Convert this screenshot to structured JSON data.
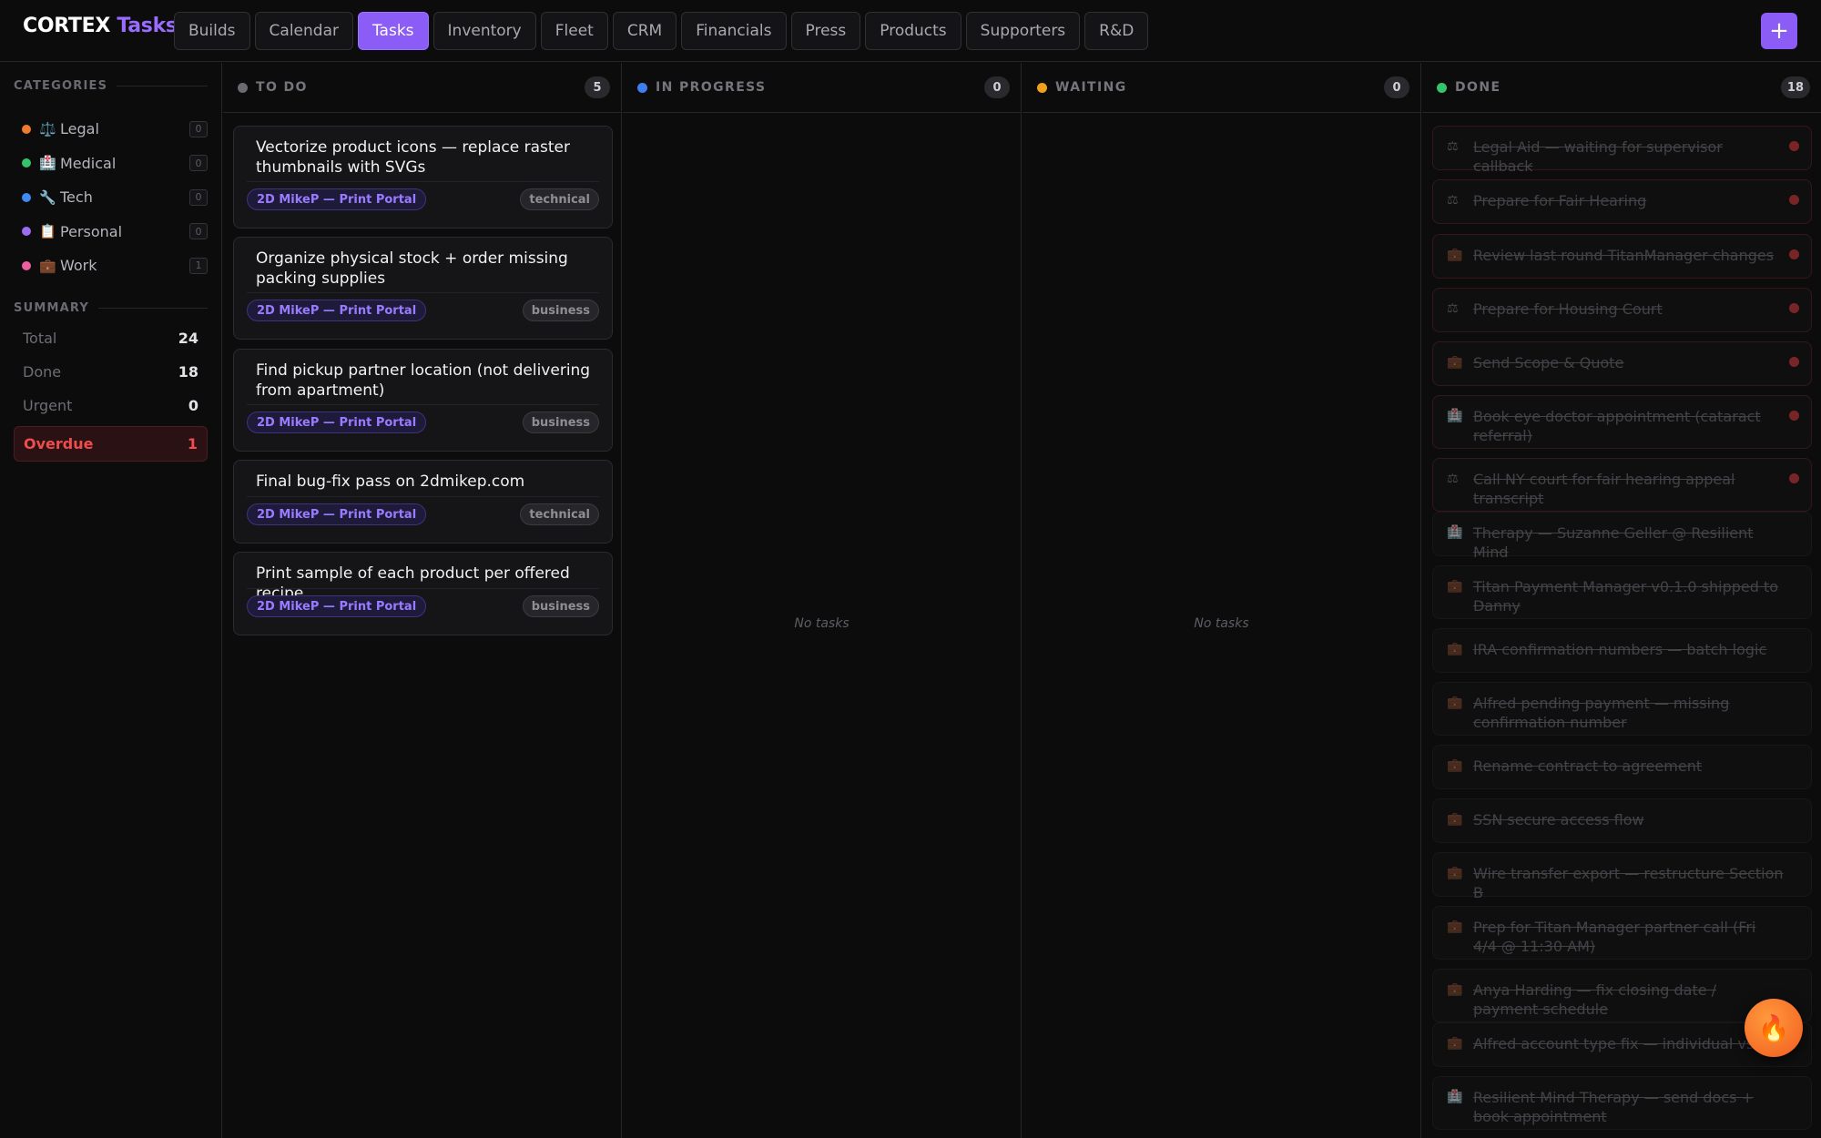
{
  "brand": {
    "name": "CORTEX",
    "accent": "Tasks"
  },
  "nav": {
    "tabs": [
      "Builds",
      "Calendar",
      "Tasks",
      "Inventory",
      "Fleet",
      "CRM",
      "Financials",
      "Press",
      "Products",
      "Supporters",
      "R&D"
    ],
    "active": "Tasks",
    "add_label": "+"
  },
  "sidebar": {
    "categories_heading": "CATEGORIES",
    "categories": [
      {
        "label": "Legal",
        "emoji": "⚖️",
        "color": "#f07b2c",
        "count": "0"
      },
      {
        "label": "Medical",
        "emoji": "🏥",
        "color": "#36c46b",
        "count": "0"
      },
      {
        "label": "Tech",
        "emoji": "🔧",
        "color": "#3f8bf0",
        "count": "0"
      },
      {
        "label": "Personal",
        "emoji": "📋",
        "color": "#9b6cf2",
        "count": "0"
      },
      {
        "label": "Work",
        "emoji": "💼",
        "color": "#ee5fa0",
        "count": "1"
      }
    ],
    "summary_heading": "SUMMARY",
    "summary": [
      {
        "label": "Total",
        "value": "24"
      },
      {
        "label": "Done",
        "value": "18"
      },
      {
        "label": "Urgent",
        "value": "0"
      }
    ],
    "overdue": {
      "label": "Overdue",
      "value": "1"
    }
  },
  "columns": {
    "todo": {
      "title": "TO DO",
      "count": "5",
      "color": "#6b6b72"
    },
    "in_progress": {
      "title": "IN PROGRESS",
      "count": "0",
      "color": "#3f7ef0",
      "empty": "No tasks"
    },
    "waiting": {
      "title": "WAITING",
      "count": "0",
      "color": "#f0a11c",
      "empty": "No tasks"
    },
    "done": {
      "title": "DONE",
      "count": "18",
      "color": "#36c46b"
    }
  },
  "todo_cards": [
    {
      "text": "Vectorize product icons — replace raster thumbnails with SVGs",
      "project": "2D MikeP — Print Portal",
      "tag": "technical"
    },
    {
      "text": "Organize physical stock + order missing packing supplies",
      "project": "2D MikeP — Print Portal",
      "tag": "business"
    },
    {
      "text": "Find pickup partner location (not delivering from apartment)",
      "project": "2D MikeP — Print Portal",
      "tag": "business"
    },
    {
      "text": "Final bug-fix pass on 2dmikep.com",
      "project": "2D MikeP — Print Portal",
      "tag": "technical"
    },
    {
      "text": "Print sample of each product per offered recipe",
      "project": "2D MikeP — Print Portal",
      "tag": "business"
    }
  ],
  "done_cards": [
    {
      "icon": "⚖",
      "text": "Legal Aid — waiting for supervisor callback",
      "urgent": true
    },
    {
      "icon": "⚖",
      "text": "Prepare for Fair Hearing",
      "urgent": true
    },
    {
      "icon": "💼",
      "text": "Review last round TitanManager changes",
      "urgent": true
    },
    {
      "icon": "⚖",
      "text": "Prepare for Housing Court",
      "urgent": true
    },
    {
      "icon": "💼",
      "text": "Send Scope & Quote",
      "urgent": true
    },
    {
      "icon": "🏥",
      "text": "Book eye doctor appointment (cataract referral)",
      "urgent": true
    },
    {
      "icon": "⚖",
      "text": "Call NY court for fair hearing appeal transcript",
      "urgent": true
    },
    {
      "icon": "🏥",
      "text": "Therapy — Suzanne Geller @ Resilient Mind",
      "urgent": false
    },
    {
      "icon": "💼",
      "text": "Titan Payment Manager v0.1.0 shipped to Danny",
      "urgent": false
    },
    {
      "icon": "💼",
      "text": "IRA confirmation numbers — batch logic",
      "urgent": false
    },
    {
      "icon": "💼",
      "text": "Alfred pending payment — missing confirmation number",
      "urgent": false
    },
    {
      "icon": "💼",
      "text": "Rename contract to agreement",
      "urgent": false
    },
    {
      "icon": "💼",
      "text": "SSN secure access flow",
      "urgent": false
    },
    {
      "icon": "💼",
      "text": "Wire transfer export — restructure Section B",
      "urgent": false
    },
    {
      "icon": "💼",
      "text": "Prep for Titan Manager partner call (Fri 4/4 @ 11:30 AM)",
      "urgent": false
    },
    {
      "icon": "💼",
      "text": "Anya Harding — fix closing date / payment schedule",
      "urgent": false
    },
    {
      "icon": "💼",
      "text": "Alfred account type fix — individual vs IRA",
      "urgent": false
    },
    {
      "icon": "🏥",
      "text": "Resilient Mind Therapy — send docs + book appointment",
      "urgent": false
    }
  ],
  "fab_icon": "🔥"
}
